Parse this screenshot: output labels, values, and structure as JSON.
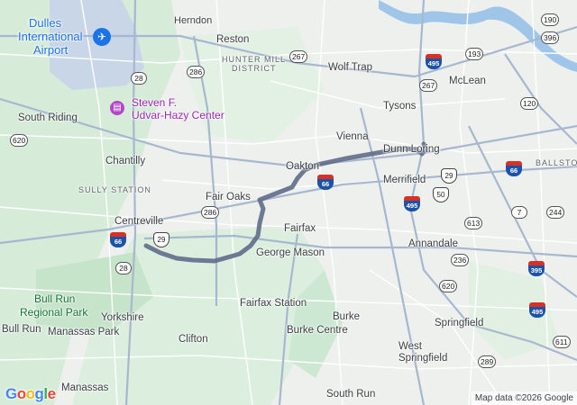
{
  "map": {
    "attribution": "Map data ©2026 Google",
    "logo": [
      "G",
      "o",
      "o",
      "g",
      "l",
      "e"
    ],
    "logo_colors": [
      "#4285F4",
      "#EA4335",
      "#FBBC05",
      "#4285F4",
      "#34A853",
      "#EA4335"
    ],
    "route_color": "#5f6b8a",
    "places": {
      "herndon": "Herndon",
      "dulles_line1": "Dulles",
      "dulles_line2": "International",
      "dulles_line3": "Airport",
      "reston": "Reston",
      "hunter_mill_1": "HUNTER MILL",
      "hunter_mill_2": "DISTRICT",
      "wolf_trap": "Wolf Trap",
      "mclean": "McLean",
      "tysons": "Tysons",
      "udvar_1": "Steven F.",
      "udvar_2": "Udvar-Hazy Center",
      "south_riding": "South Riding",
      "vienna": "Vienna",
      "dunn_loring": "Dunn Loring",
      "ballston": "BALLSTON",
      "chantilly": "Chantilly",
      "oakton": "Oakton",
      "merrifield": "Merrifield",
      "sully_station": "SULLY STATION",
      "fair_oaks": "Fair Oaks",
      "centreville": "Centreville",
      "fairfax": "Fairfax",
      "annandale": "Annandale",
      "george_mason": "George Mason",
      "bull_run_park_1": "Bull Run",
      "bull_run_park_2": "Regional Park",
      "fairfax_station": "Fairfax Station",
      "yorkshire": "Yorkshire",
      "burke": "Burke",
      "springfield": "Springfield",
      "bull_run": "Bull Run",
      "manassas_park": "Manassas Park",
      "clifton": "Clifton",
      "burke_centre": "Burke Centre",
      "west_springfield_1": "West",
      "west_springfield_2": "Springfield",
      "manassas": "Manassas",
      "south_run": "South Run"
    },
    "shields": {
      "s190": "190",
      "s396": "396",
      "s193": "193",
      "s267a": "267",
      "s267b": "267",
      "s286a": "286",
      "s286b": "286",
      "s28a": "28",
      "s28b": "28",
      "s620a": "620",
      "s620b": "620",
      "s120": "120",
      "s7": "7",
      "s244": "244",
      "s613": "613",
      "s236": "236",
      "s289": "289",
      "s611": "611",
      "i495a": "495",
      "i495b": "495",
      "i495c": "495",
      "i66a": "66",
      "i66b": "66",
      "i66c": "66",
      "i395": "395",
      "us29a": "29",
      "us29b": "29",
      "us50": "50"
    }
  }
}
